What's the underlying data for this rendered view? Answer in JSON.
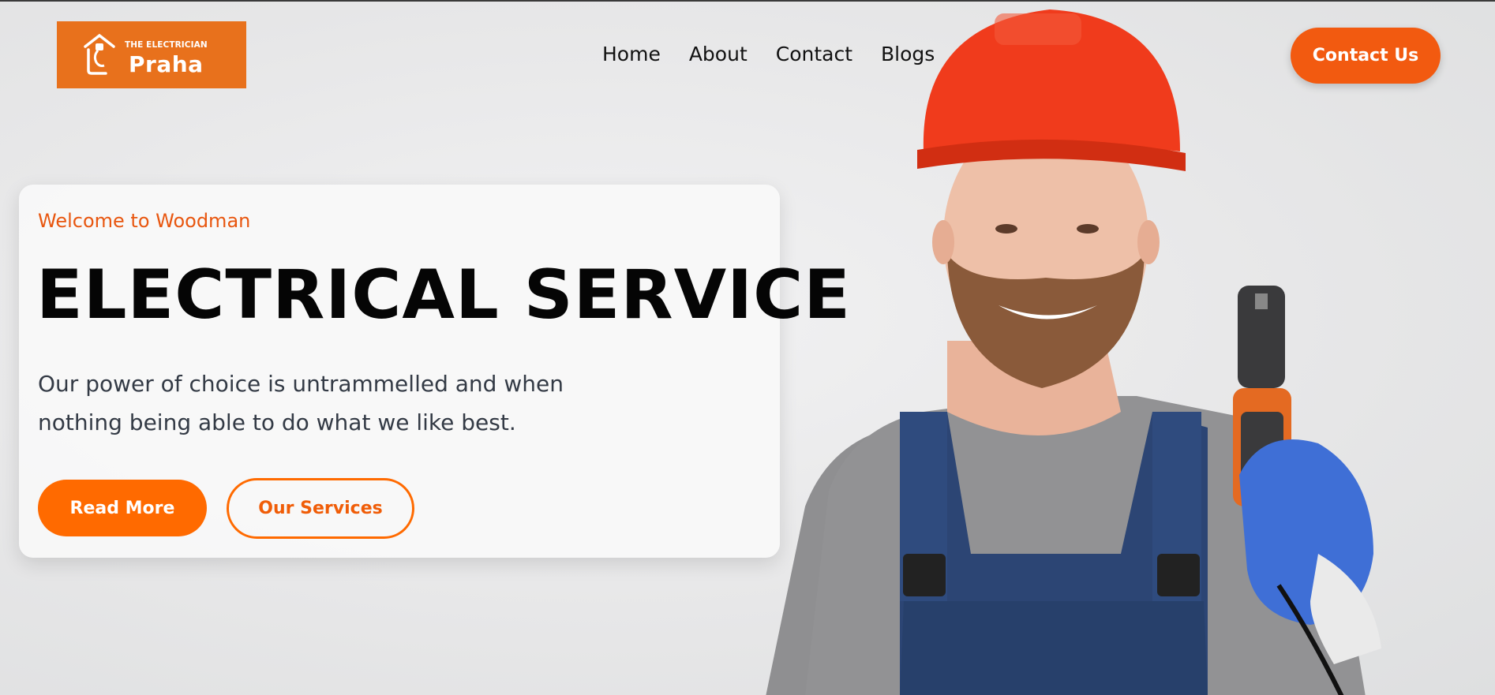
{
  "header": {
    "logo": {
      "tagline": "THE ELECTRICIAN",
      "name": "Praha",
      "icon": "house-plug-icon"
    },
    "nav": [
      "Home",
      "About",
      "Contact",
      "Blogs"
    ],
    "cta_label": "Contact Us"
  },
  "hero": {
    "eyebrow": "Welcome to Woodman",
    "headline": "ELECTRICAL SERVICE",
    "description": "Our power of choice is untrammelled and when nothing being able to do what we like best.",
    "primary_button": "Read More",
    "secondary_button": "Our Services",
    "image": "electrician-with-drill-photo"
  },
  "colors": {
    "accent": "#f25a10",
    "logo_bg": "#e8711c",
    "button": "#ff6a00",
    "headline": "#050505",
    "background": "#e9e9ea"
  }
}
